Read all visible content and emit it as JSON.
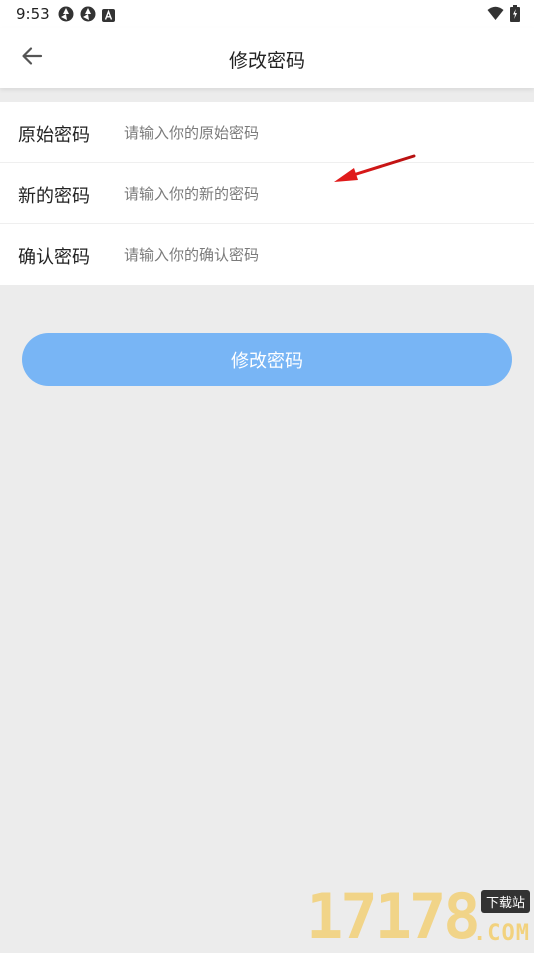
{
  "status_bar": {
    "time": "9:53",
    "icons_left": [
      "aperture-icon",
      "aperture-icon",
      "text-a-icon"
    ],
    "icons_right": [
      "wifi-icon",
      "battery-icon"
    ]
  },
  "app_bar": {
    "back_icon": "arrow-left-icon",
    "title": "修改密码"
  },
  "form": {
    "rows": [
      {
        "label": "原始密码",
        "placeholder": "请输入你的原始密码",
        "value": ""
      },
      {
        "label": "新的密码",
        "placeholder": "请输入你的新的密码",
        "value": ""
      },
      {
        "label": "确认密码",
        "placeholder": "请输入你的确认密码",
        "value": ""
      }
    ]
  },
  "submit": {
    "label": "修改密码"
  },
  "colors": {
    "accent": "#78b5f5",
    "background": "#ececec",
    "annotation": "#e01b1b"
  },
  "watermark": {
    "digits": "17178",
    "badge": "下载站",
    "suffix": ".COM"
  }
}
